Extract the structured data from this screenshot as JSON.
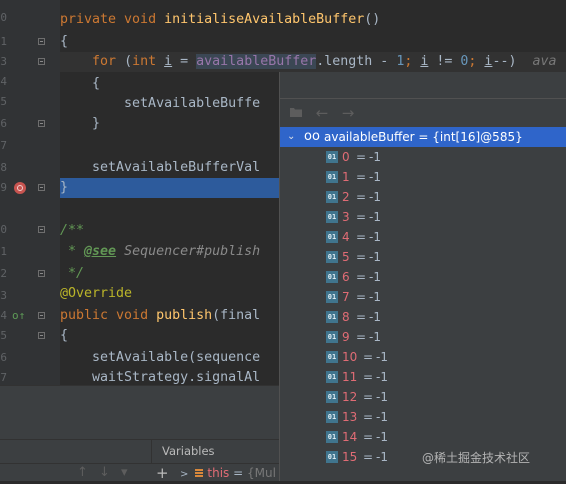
{
  "editor": {
    "line_numbers": [
      "0",
      "1",
      "3",
      "4",
      "5",
      "6",
      "7",
      "8",
      "9",
      "0",
      "1",
      "2",
      "3",
      "4",
      "5",
      "6",
      "7",
      "8"
    ],
    "code_lines": {
      "l1": [
        "private ",
        "void ",
        "initialiseAvailableBuffer",
        "()"
      ],
      "l2": [
        "{"
      ],
      "l3": [
        "    ",
        "for",
        " (",
        "int ",
        "i",
        " = ",
        "availableBuffer",
        ".length - ",
        "1",
        "; ",
        "i",
        " != ",
        "0",
        "; ",
        "i",
        "--)",
        "  ava"
      ],
      "l4": [
        "    {"
      ],
      "l5": [
        "        setAvailableBuffe"
      ],
      "l6": [
        "    }"
      ],
      "l8": [
        "    setAvailableBufferVal"
      ],
      "l9": [
        "}"
      ],
      "l11": [
        "/**"
      ],
      "l12": [
        " * ",
        "@see",
        " Sequencer#publish"
      ],
      "l13": [
        " */"
      ],
      "l14": [
        "@Override"
      ],
      "l15": [
        "public ",
        "void ",
        "publish",
        "(final"
      ],
      "l16": [
        "{"
      ],
      "l17": [
        "    setAvailable(sequence"
      ],
      "l18": [
        "    waitStrategy.signalAl"
      ]
    },
    "override_marker": "o↑"
  },
  "popup": {
    "toolbar": {
      "folder_icon": "folder-icon",
      "back_icon": "←",
      "forward_icon": "→"
    },
    "root": {
      "chevron": "⌄",
      "glasses_icon": "oo",
      "label": "availableBuffer = {int[16]@585}"
    },
    "items": [
      {
        "icon": "01",
        "index": "0",
        "eq": "=",
        "value": "-1"
      },
      {
        "icon": "01",
        "index": "1",
        "eq": "=",
        "value": "-1"
      },
      {
        "icon": "01",
        "index": "2",
        "eq": "=",
        "value": "-1"
      },
      {
        "icon": "01",
        "index": "3",
        "eq": "=",
        "value": "-1"
      },
      {
        "icon": "01",
        "index": "4",
        "eq": "=",
        "value": "-1"
      },
      {
        "icon": "01",
        "index": "5",
        "eq": "=",
        "value": "-1"
      },
      {
        "icon": "01",
        "index": "6",
        "eq": "=",
        "value": "-1"
      },
      {
        "icon": "01",
        "index": "7",
        "eq": "=",
        "value": "-1"
      },
      {
        "icon": "01",
        "index": "8",
        "eq": "=",
        "value": "-1"
      },
      {
        "icon": "01",
        "index": "9",
        "eq": "=",
        "value": "-1"
      },
      {
        "icon": "01",
        "index": "10",
        "eq": "=",
        "value": "-1"
      },
      {
        "icon": "01",
        "index": "11",
        "eq": "=",
        "value": "-1"
      },
      {
        "icon": "01",
        "index": "12",
        "eq": "=",
        "value": "-1"
      },
      {
        "icon": "01",
        "index": "13",
        "eq": "=",
        "value": "-1"
      },
      {
        "icon": "01",
        "index": "14",
        "eq": "=",
        "value": "-1"
      },
      {
        "icon": "01",
        "index": "15",
        "eq": "=",
        "value": "-1"
      }
    ]
  },
  "bottom": {
    "variables_title": "Variables",
    "toolbar": {
      "up": "↑",
      "down": "↓",
      "add": "+"
    },
    "var_row": {
      "chevron": ">",
      "name": "this",
      "eq": " = ",
      "value": "{Mul"
    }
  },
  "watermark": "@稀土掘金技术社区",
  "colors": {
    "editor_bg": "#2b2b2b",
    "breakpoint_line": "#2d5b9c",
    "selection": "#2f65ca",
    "keyword": "#cc7832",
    "method": "#ffc66d",
    "number": "#6897bb",
    "field": "#9876aa"
  }
}
